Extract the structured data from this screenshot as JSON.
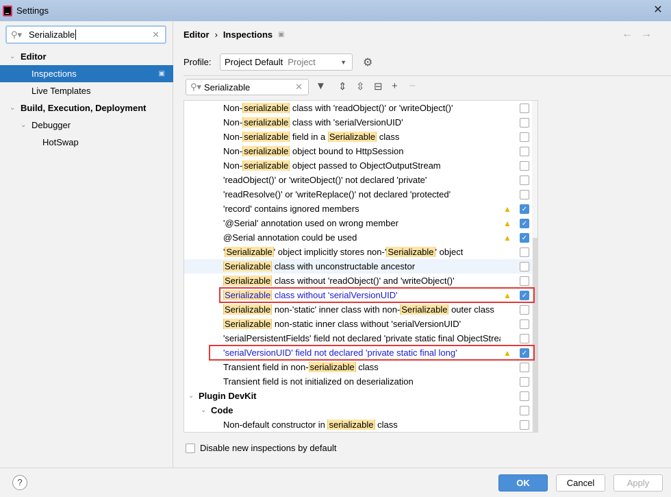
{
  "window": {
    "title": "Settings",
    "close_icon": "close-icon"
  },
  "sidebar": {
    "search_value": "Serializable",
    "items": [
      {
        "label": "Editor",
        "level": 0,
        "bold": true,
        "expanded": true
      },
      {
        "label": "Inspections",
        "level": 1,
        "selected": true
      },
      {
        "label": "Live Templates",
        "level": 1
      },
      {
        "label": "Build, Execution, Deployment",
        "level": 0,
        "bold": true,
        "expanded": true
      },
      {
        "label": "Debugger",
        "level": 1,
        "expanded": true
      },
      {
        "label": "HotSwap",
        "level": 2
      }
    ]
  },
  "breadcrumb": {
    "parent": "Editor",
    "sep": "›",
    "current": "Inspections"
  },
  "profile": {
    "label": "Profile:",
    "value": "Project Default",
    "scope": "Project"
  },
  "filter": {
    "value": "Serializable"
  },
  "inspections": [
    {
      "segs": [
        [
          "Non-",
          0
        ],
        [
          "serializable",
          1
        ],
        [
          " class with 'readObject()' or 'writeObject()'",
          0
        ]
      ],
      "checked": false
    },
    {
      "segs": [
        [
          "Non-",
          0
        ],
        [
          "serializable",
          1
        ],
        [
          " class with 'serialVersionUID'",
          0
        ]
      ],
      "checked": false
    },
    {
      "segs": [
        [
          "Non-",
          0
        ],
        [
          "serializable",
          1
        ],
        [
          " field in a ",
          0
        ],
        [
          "Serializable",
          1
        ],
        [
          " class",
          0
        ]
      ],
      "checked": false
    },
    {
      "segs": [
        [
          "Non-",
          0
        ],
        [
          "serializable",
          1
        ],
        [
          " object bound to HttpSession",
          0
        ]
      ],
      "checked": false
    },
    {
      "segs": [
        [
          "Non-",
          0
        ],
        [
          "serializable",
          1
        ],
        [
          " object passed to ObjectOutputStream",
          0
        ]
      ],
      "checked": false
    },
    {
      "segs": [
        [
          "'readObject()' or 'writeObject()' not declared 'private'",
          0
        ]
      ],
      "checked": false
    },
    {
      "segs": [
        [
          "'readResolve()' or 'writeReplace()' not declared 'protected'",
          0
        ]
      ],
      "checked": false
    },
    {
      "segs": [
        [
          "'record' contains ignored members",
          0
        ]
      ],
      "checked": true,
      "warning": true
    },
    {
      "segs": [
        [
          "'@Serial' annotation used on wrong member",
          0
        ]
      ],
      "checked": true,
      "warning": true
    },
    {
      "segs": [
        [
          "@Serial annotation could be used",
          0
        ]
      ],
      "checked": true,
      "warning": true
    },
    {
      "segs": [
        [
          "'",
          0
        ],
        [
          "Serializable",
          1
        ],
        [
          "' object implicitly stores non-'",
          0
        ],
        [
          "Serializable",
          1
        ],
        [
          "' object",
          0
        ]
      ],
      "checked": false
    },
    {
      "segs": [
        [
          "Serializable",
          1
        ],
        [
          " class with unconstructable ancestor",
          0
        ]
      ],
      "checked": false,
      "hover": true
    },
    {
      "segs": [
        [
          "Serializable",
          1
        ],
        [
          " class without 'readObject()' and 'writeObject()'",
          0
        ]
      ],
      "checked": false
    },
    {
      "segs": [
        [
          "Serializable",
          1
        ],
        [
          " class without 'serialVersionUID'",
          0
        ]
      ],
      "checked": true,
      "warning": true,
      "modified": true,
      "boxed": true
    },
    {
      "segs": [
        [
          "Serializable",
          1
        ],
        [
          " non-'static' inner class with non-",
          0
        ],
        [
          "Serializable",
          1
        ],
        [
          " outer class",
          0
        ]
      ],
      "checked": false
    },
    {
      "segs": [
        [
          "Serializable",
          1
        ],
        [
          " non-static inner class without 'serialVersionUID'",
          0
        ]
      ],
      "checked": false
    },
    {
      "segs": [
        [
          "'serialPersistentFields' field not declared 'private static final ObjectStreamField[]'",
          0
        ]
      ],
      "checked": false
    },
    {
      "segs": [
        [
          "'serialVersionUID' field not declared 'private static final long'",
          0
        ]
      ],
      "checked": true,
      "warning": true,
      "modified": true,
      "boxed": true
    },
    {
      "segs": [
        [
          "Transient field in non-",
          0
        ],
        [
          "serializable",
          1
        ],
        [
          " class",
          0
        ]
      ],
      "checked": false
    },
    {
      "segs": [
        [
          "Transient field is not initialized on deserialization",
          0
        ]
      ],
      "checked": false
    },
    {
      "group": "Plugin DevKit",
      "level": 0,
      "checked": false
    },
    {
      "group": "Code",
      "level": 1,
      "checked": false
    },
    {
      "segs": [
        [
          "Non-default constructor in ",
          0
        ],
        [
          "serializable",
          1
        ],
        [
          " class",
          0
        ]
      ],
      "checked": false
    }
  ],
  "disable_new": {
    "label": "Disable new inspections by default",
    "checked": false
  },
  "footer": {
    "help": "?",
    "ok": "OK",
    "cancel": "Cancel",
    "apply": "Apply"
  },
  "colors": {
    "selection": "#2675bf",
    "highlight": "#fce4a3",
    "modified_text": "#1a1acc",
    "warning": "#e8b500",
    "red_box": "#e53935",
    "ok_button": "#4a8fd8"
  }
}
